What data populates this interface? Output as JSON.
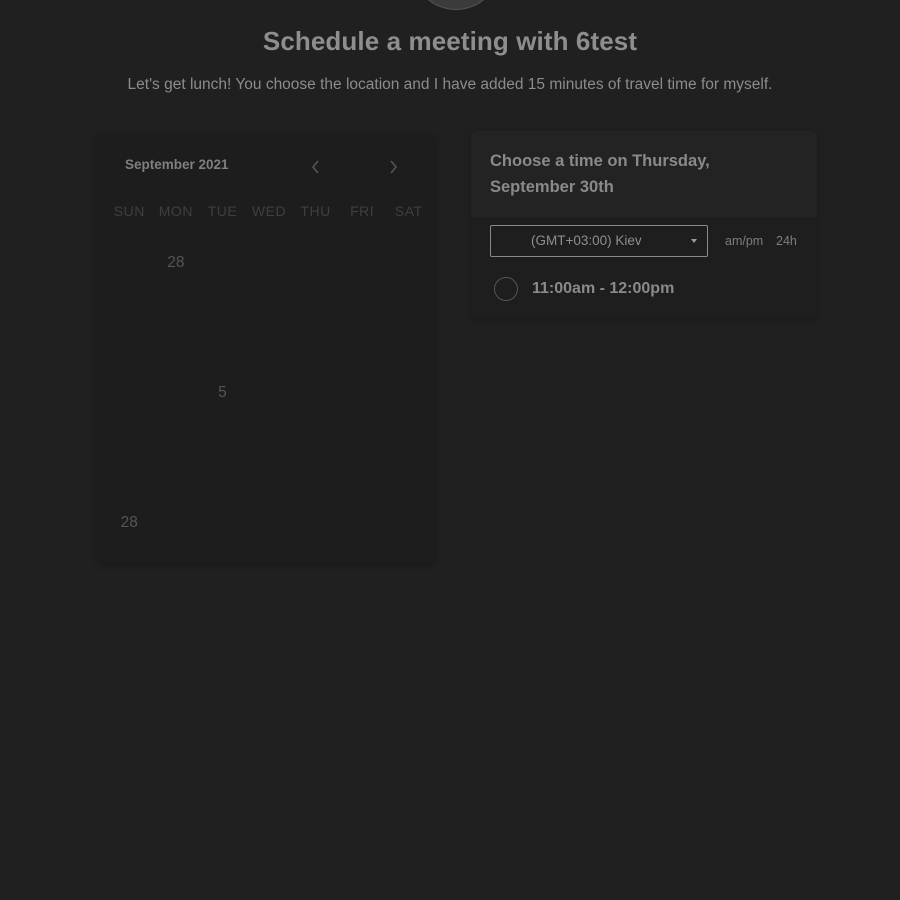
{
  "header": {
    "title": "Schedule a meeting with 6test",
    "subtitle": "Let's get lunch! You choose the location and I have added 15 minutes of travel time for myself."
  },
  "calendar": {
    "month_label": "September 2021",
    "prev_icon": "chevron-left-icon",
    "next_icon": "chevron-right-icon",
    "weekdays": [
      "SUN",
      "MON",
      "TUE",
      "WED",
      "THU",
      "FRI",
      "SAT"
    ],
    "weeks": [
      [
        "",
        "28",
        "",
        "",
        "",
        "",
        ""
      ],
      [
        "",
        "",
        "",
        "",
        "",
        "",
        ""
      ],
      [
        "",
        "",
        "5",
        "",
        "",
        "",
        ""
      ],
      [
        "",
        "",
        "",
        "",
        "",
        "",
        ""
      ],
      [
        "28",
        "",
        "",
        "",
        "",
        "",
        ""
      ]
    ]
  },
  "time_panel": {
    "heading": "Choose a time on Thursday, September 30th",
    "timezone": "(GMT+03:00) Kiev",
    "format_12h": "am/pm",
    "format_24h": "24h",
    "slots": [
      {
        "label": "11:00am - 12:00pm"
      }
    ]
  }
}
